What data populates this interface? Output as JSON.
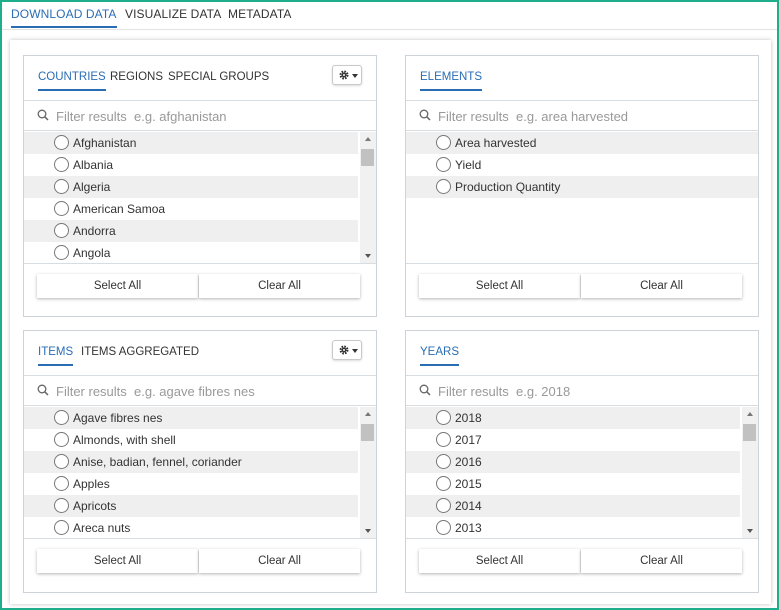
{
  "top_tabs": [
    {
      "label": "DOWNLOAD DATA"
    },
    {
      "label": "VISUALIZE DATA"
    },
    {
      "label": "METADATA"
    }
  ],
  "panels": {
    "countries": {
      "tabs": [
        "COUNTRIES",
        "REGIONS",
        "SPECIAL GROUPS"
      ],
      "placeholder": "Filter results  e.g. afghanistan",
      "items": [
        "Afghanistan",
        "Albania",
        "Algeria",
        "American Samoa",
        "Andorra",
        "Angola"
      ],
      "select_all": "Select All",
      "clear_all": "Clear All"
    },
    "elements": {
      "tabs": [
        "ELEMENTS"
      ],
      "placeholder": "Filter results  e.g. area harvested",
      "items": [
        "Area harvested",
        "Yield",
        "Production Quantity"
      ],
      "select_all": "Select All",
      "clear_all": "Clear All"
    },
    "items": {
      "tabs": [
        "ITEMS",
        "ITEMS AGGREGATED"
      ],
      "placeholder": "Filter results  e.g. agave fibres nes",
      "items": [
        "Agave fibres nes",
        "Almonds, with shell",
        "Anise, badian, fennel, coriander",
        "Apples",
        "Apricots",
        "Areca nuts"
      ],
      "select_all": "Select All",
      "clear_all": "Clear All"
    },
    "years": {
      "tabs": [
        "YEARS"
      ],
      "placeholder": "Filter results  e.g. 2018",
      "items": [
        "2018",
        "2017",
        "2016",
        "2015",
        "2014",
        "2013"
      ],
      "select_all": "Select All",
      "clear_all": "Clear All"
    }
  },
  "icons": {
    "gear": "gear-icon",
    "search": "search-icon",
    "radio": "radio-icon"
  },
  "colors": {
    "accent": "#2a6db5",
    "frame": "#1fae8c",
    "row_alt": "#efefef"
  }
}
